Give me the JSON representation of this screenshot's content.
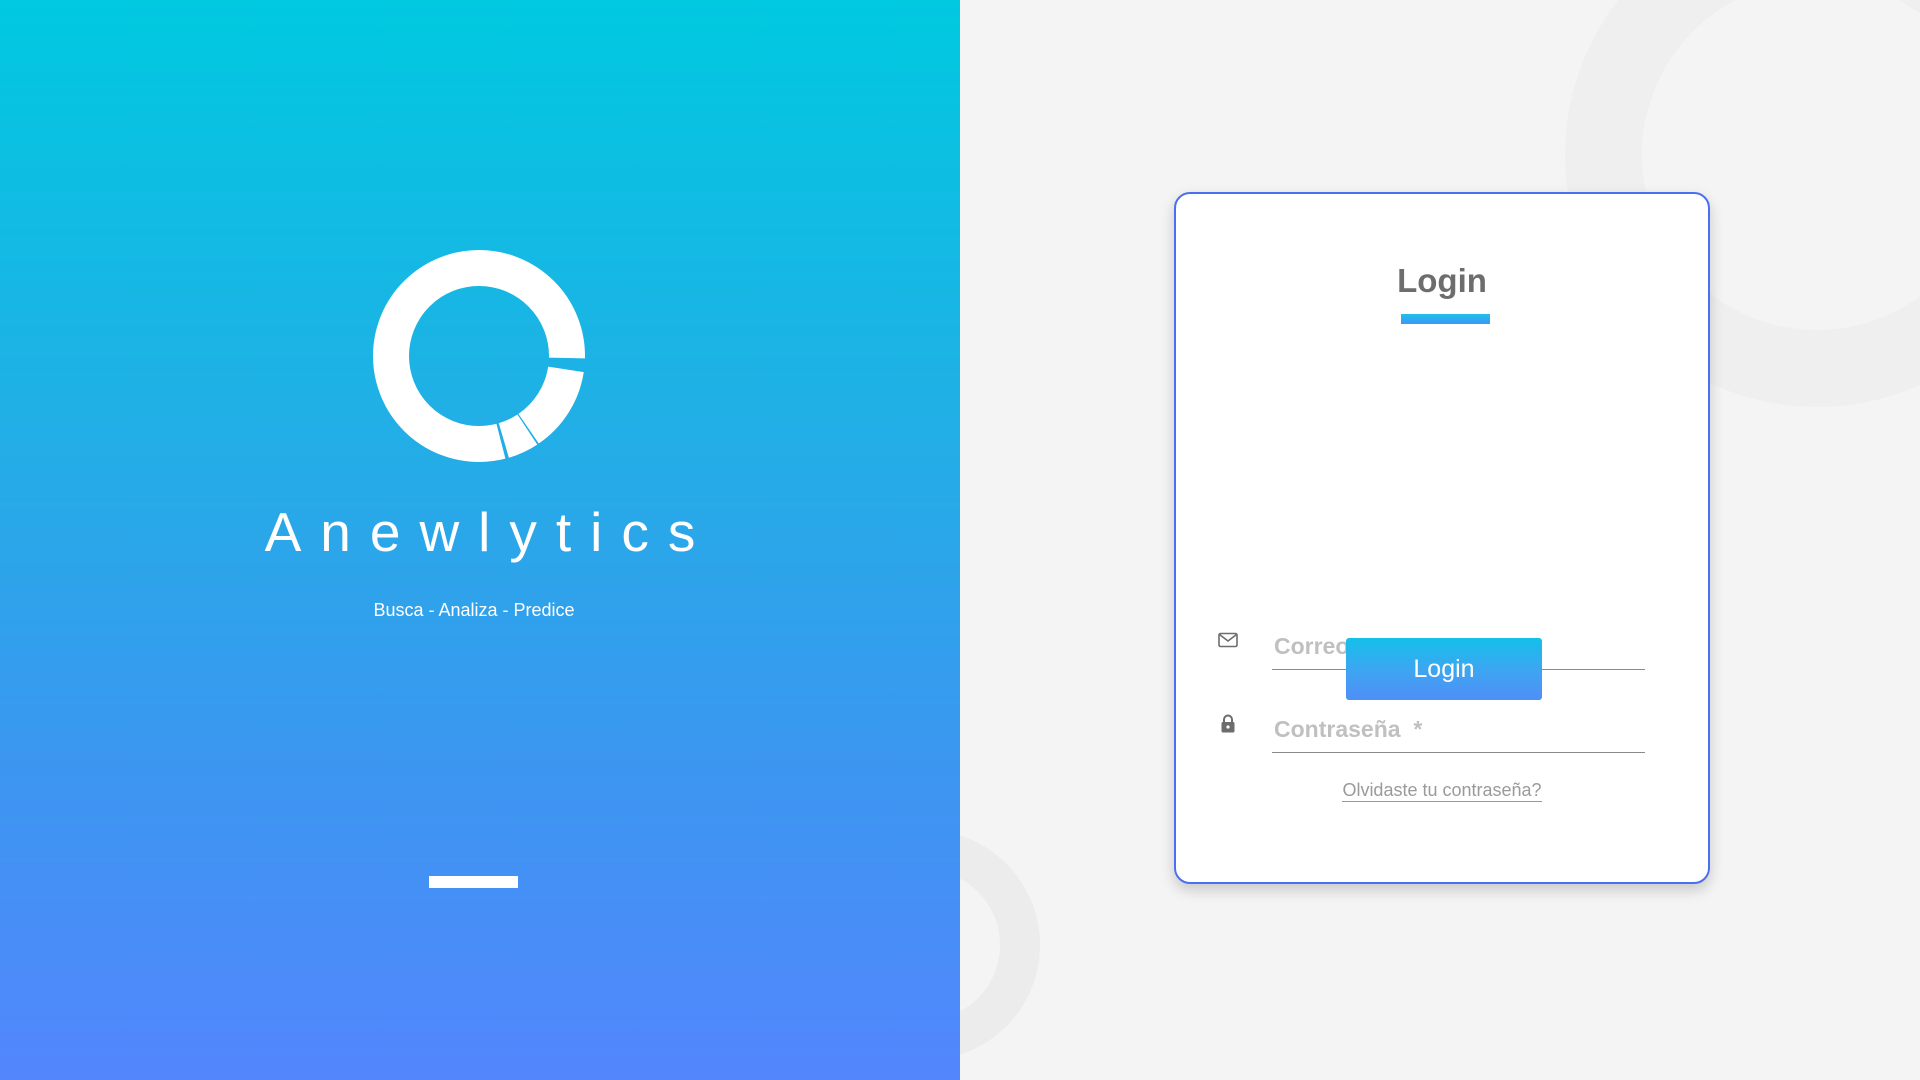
{
  "brand": {
    "name": "Anewlytics",
    "tagline": "Busca - Analiza - Predice",
    "logo_icon": "ring-logo-icon"
  },
  "login_card": {
    "title": "Login",
    "email": {
      "placeholder": "Correo *",
      "value": "",
      "icon": "mail-icon"
    },
    "password": {
      "placeholder": "Contraseña  *",
      "value": "",
      "icon": "lock-icon"
    },
    "submit_label": "Login",
    "forgot_password_label": "Olvidaste tu contraseña?"
  },
  "colors": {
    "gradient_top": "#00c9e0",
    "gradient_bottom": "#5386fd",
    "card_border": "#4c6ff0",
    "title_text": "#6d6d6d",
    "background": "#f4f4f4"
  }
}
